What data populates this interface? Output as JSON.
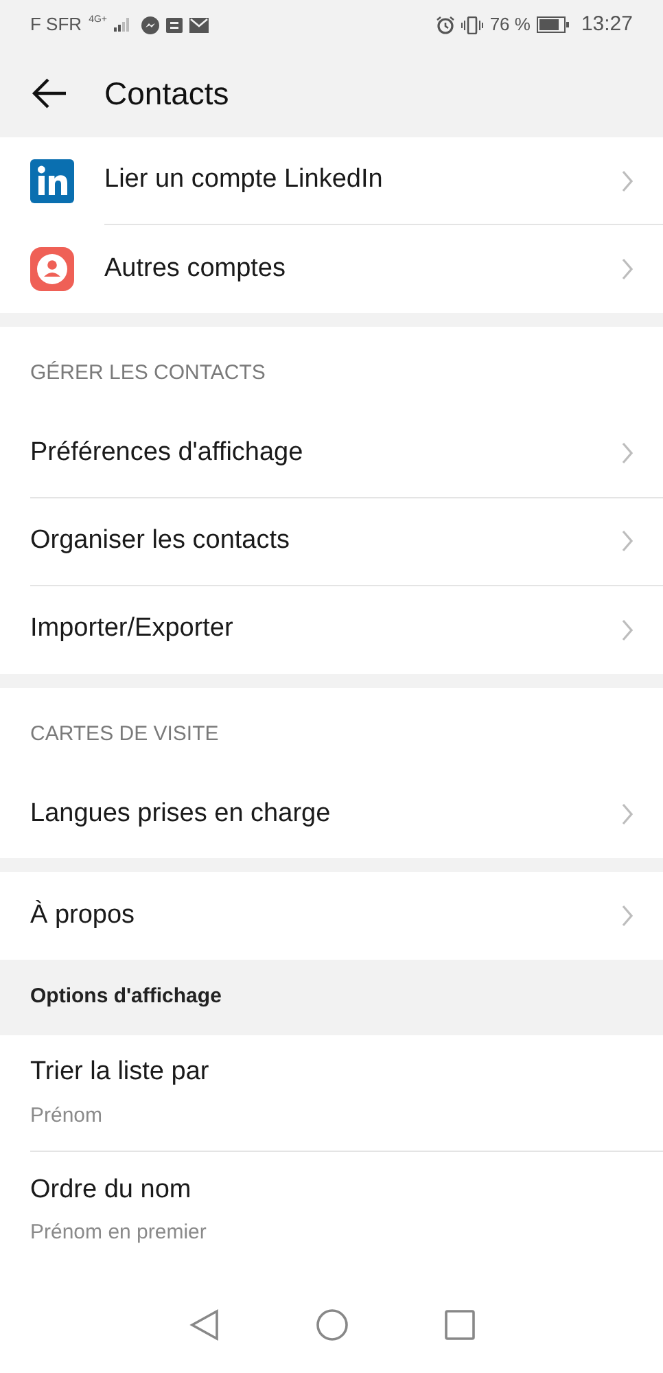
{
  "status_bar": {
    "carrier": "F SFR",
    "network": "4G+",
    "battery": "76 %",
    "time": "13:27"
  },
  "header": {
    "title": "Contacts"
  },
  "sections": [
    {
      "kind": "accounts",
      "items": [
        {
          "kind": "link",
          "label": "Lier un compte LinkedIn"
        },
        {
          "kind": "link",
          "label": "Autres comptes"
        }
      ]
    },
    {
      "kind": "titled",
      "title": "GÉRER LES CONTACTS",
      "items": [
        {
          "kind": "link",
          "label": "Préférences d'affichage"
        },
        {
          "kind": "link",
          "label": "Organiser les contacts"
        },
        {
          "kind": "link",
          "label": "Importer/Exporter"
        }
      ]
    },
    {
      "kind": "titled",
      "title": "CARTES DE VISITE",
      "items": [
        {
          "kind": "link",
          "label": "Langues prises en charge"
        }
      ]
    },
    {
      "kind": "plain",
      "items": [
        {
          "kind": "link",
          "label": "À propos"
        }
      ]
    },
    {
      "kind": "options",
      "title": "Options d'affichage",
      "items": [
        {
          "kind": "value",
          "label": "Trier la liste par",
          "value": "Prénom"
        },
        {
          "kind": "value",
          "label": "Ordre du nom",
          "value": "Prénom en premier"
        }
      ]
    }
  ]
}
